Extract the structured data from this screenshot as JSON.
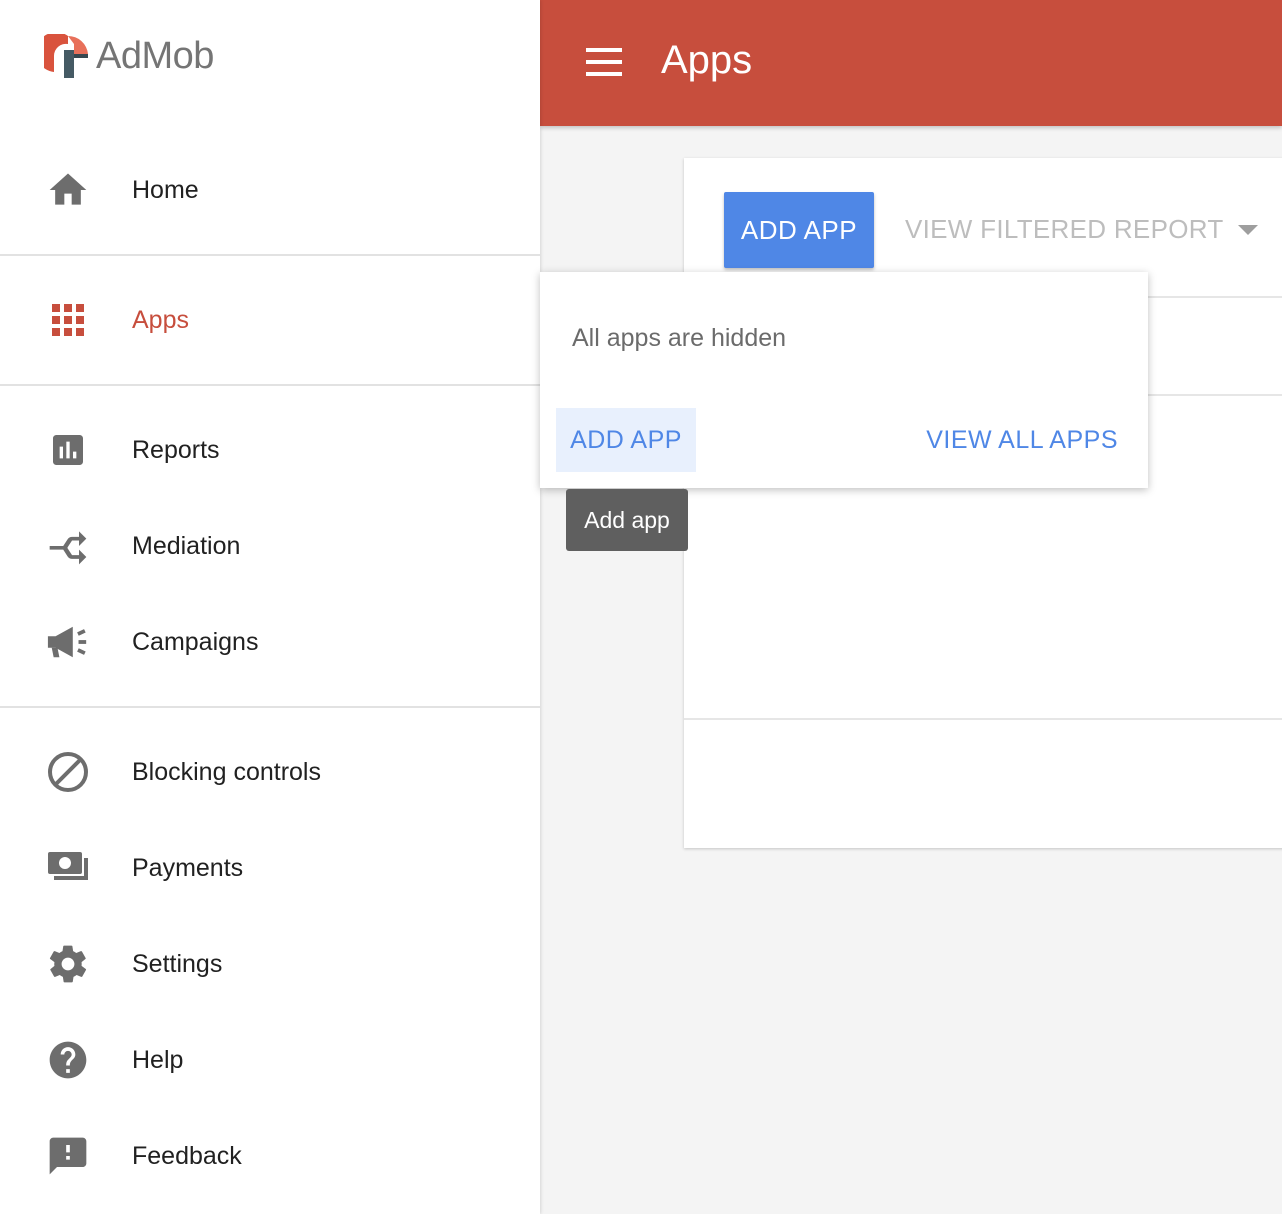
{
  "app": {
    "name": "AdMob",
    "brand_color": "#c74e3d",
    "accent_color": "#4f87e6"
  },
  "topbar": {
    "title": "Apps"
  },
  "sidebar": {
    "items": [
      {
        "label": "Home",
        "icon": "home-icon"
      },
      {
        "label": "Apps",
        "icon": "apps-grid-icon",
        "active": true
      },
      {
        "label": "Reports",
        "icon": "bar-chart-icon"
      },
      {
        "label": "Mediation",
        "icon": "mediation-icon"
      },
      {
        "label": "Campaigns",
        "icon": "megaphone-icon"
      },
      {
        "label": "Blocking controls",
        "icon": "block-icon"
      },
      {
        "label": "Payments",
        "icon": "payments-icon"
      },
      {
        "label": "Settings",
        "icon": "gear-icon"
      },
      {
        "label": "Help",
        "icon": "help-icon"
      },
      {
        "label": "Feedback",
        "icon": "feedback-icon"
      }
    ]
  },
  "card": {
    "add_app_label": "ADD APP",
    "filter_label": "VIEW FILTERED REPORT"
  },
  "popup": {
    "message": "All apps are hidden",
    "add_app_label": "ADD APP",
    "view_all_label": "VIEW ALL APPS"
  },
  "tooltip": {
    "text": "Add app"
  }
}
